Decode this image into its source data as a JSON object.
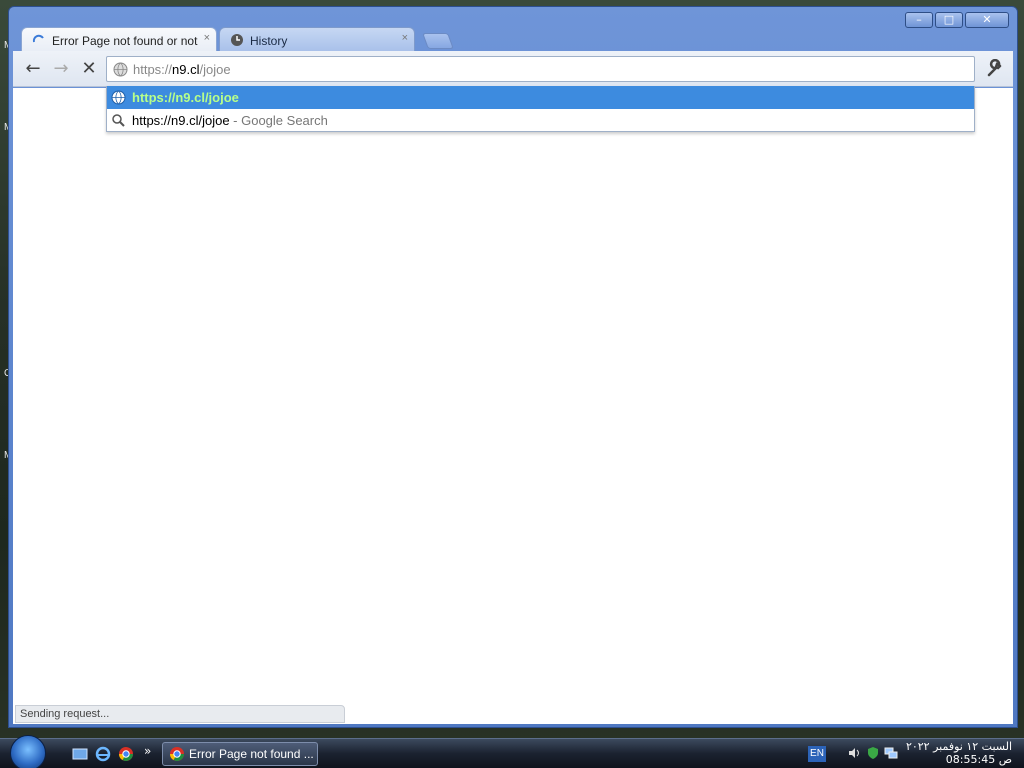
{
  "window": {
    "minimize": "–",
    "maximize": "□",
    "close": "✕"
  },
  "tabs": [
    {
      "label": "Error Page not found or not av",
      "close": "×",
      "icon": "loading-spinner-icon"
    },
    {
      "label": "History",
      "close": "×",
      "icon": "clock-icon"
    }
  ],
  "toolbar": {
    "back": "←",
    "forward": "→",
    "stop": "✕",
    "omnibox": {
      "scheme": "https://",
      "typed": "n9.cl",
      "autocomplete": "/jojoe"
    }
  },
  "suggestions": [
    {
      "text": "https://n9.cl/jojoe",
      "desc": "",
      "icon": "globe-icon",
      "selected": true
    },
    {
      "text": "https://n9.cl/jojoe",
      "desc": " - Google Search",
      "icon": "search-icon",
      "selected": false
    }
  ],
  "status": "Sending request...",
  "taskbar": {
    "task_label": "Error Page not found ...",
    "lang": "EN",
    "more": "»",
    "clock_date": "السبت ١٢ نوفمبر ٢٠٢٢",
    "clock_time": "ص 08:55:45"
  },
  "desktop_letters": [
    "M",
    "M",
    "G",
    "M"
  ]
}
